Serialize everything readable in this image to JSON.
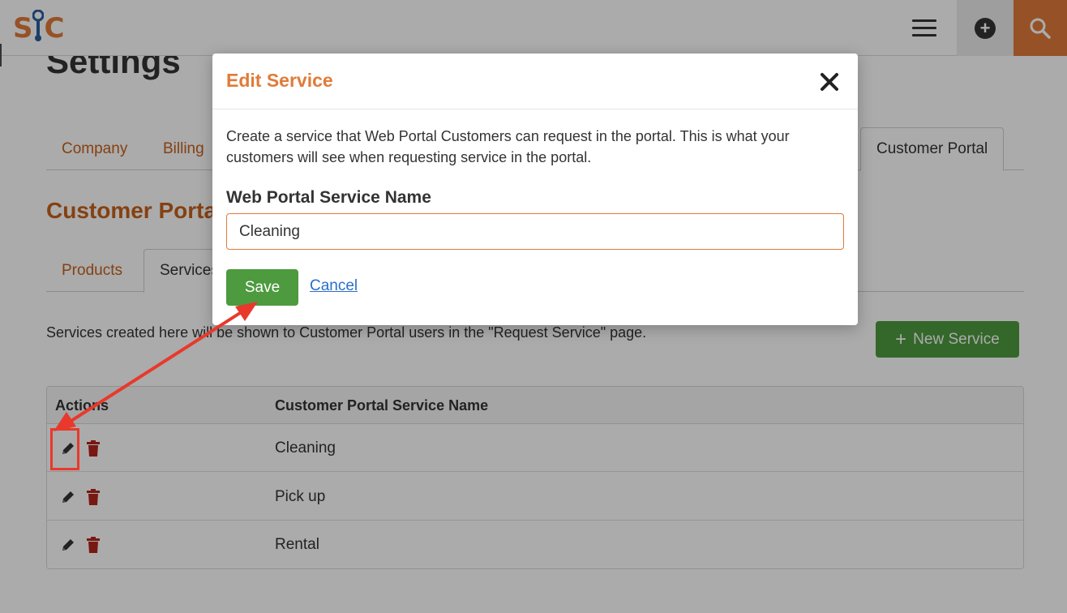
{
  "navbar": {
    "logo_left": "S",
    "logo_right": "C",
    "menu_icon": "hamburger-icon",
    "add_icon": "plus-circle-icon",
    "search_icon": "search-icon",
    "accent_color": "#e07b39"
  },
  "page": {
    "title": "Settings",
    "main_tabs": [
      "Company",
      "Billing",
      "Customer Portal"
    ],
    "active_main_tab": "Customer Portal",
    "section_title": "Customer Portal",
    "sub_tabs": [
      "Products",
      "Services"
    ],
    "active_sub_tab": "Services",
    "info_text": "Services created here will be shown to Customer Portal users in the \"Request Service\" page.",
    "new_service_label": "New Service"
  },
  "table": {
    "headers": [
      "Actions",
      "Customer Portal Service Name"
    ],
    "rows": [
      {
        "name": "Cleaning"
      },
      {
        "name": "Pick up"
      },
      {
        "name": "Rental"
      }
    ],
    "edit_icon": "pencil-icon",
    "delete_icon": "trash-icon",
    "delete_color": "#b3241c"
  },
  "modal": {
    "title": "Edit Service",
    "description": "Create a service that Web Portal Customers can request in the portal. This is what your customers will see when requesting service in the portal.",
    "field_label": "Web Portal Service Name",
    "field_value": "Cleaning",
    "save_label": "Save",
    "cancel_label": "Cancel",
    "close_icon": "close-icon"
  },
  "annotation": {
    "color": "#e8392c"
  }
}
